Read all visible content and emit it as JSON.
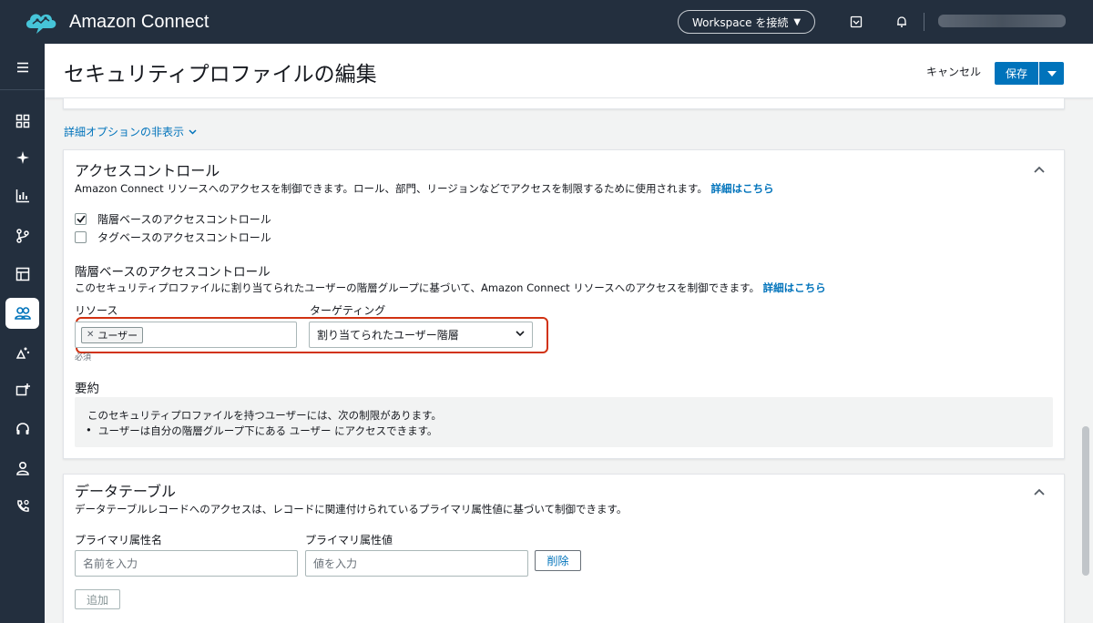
{
  "app": {
    "title": "Amazon Connect"
  },
  "topbar": {
    "workspace_label": "Workspace を接続"
  },
  "page": {
    "title": "セキュリティプロファイルの編集",
    "cancel_label": "キャンセル",
    "save_label": "保存"
  },
  "advanced_toggle": "詳細オプションの非表示",
  "access_control": {
    "title": "アクセスコントロール",
    "description": "Amazon Connect リソースへのアクセスを制御できます。ロール、部門、リージョンなどでアクセスを制限するために使用されます。",
    "learn_more": "詳細はこちら",
    "checkboxes": [
      {
        "label": "階層ベースのアクセスコントロール",
        "checked": true
      },
      {
        "label": "タグベースのアクセスコントロール",
        "checked": false
      }
    ],
    "hierarchy": {
      "title": "階層ベースのアクセスコントロール",
      "description": "このセキュリティプロファイルに割り当てられたユーザーの階層グループに基づいて、Amazon Connect リソースへのアクセスを制御できます。",
      "learn_more": "詳細はこちら",
      "resource_label": "リソース",
      "resource_token": "ユーザー",
      "targeting_label": "ターゲティング",
      "targeting_value": "割り当てられたユーザー階層",
      "required_note": "必須"
    },
    "summary": {
      "title": "要約",
      "line1": "このセキュリティプロファイルを持つユーザーには、次の制限があります。",
      "line2": "ユーザーは自分の階層グループ下にある ユーザー にアクセスできます。"
    }
  },
  "data_table": {
    "title": "データテーブル",
    "description": "データテーブルレコードへのアクセスは、レコードに関連付けられているプライマリ属性値に基づいて制御できます。",
    "name_label": "プライマリ属性名",
    "name_placeholder": "名前を入力",
    "value_label": "プライマリ属性値",
    "value_placeholder": "値を入力",
    "delete_label": "削除",
    "add_label": "追加"
  },
  "colors": {
    "topbar": "#232f3e",
    "primary": "#0073bb",
    "highlight": "#d13212"
  }
}
